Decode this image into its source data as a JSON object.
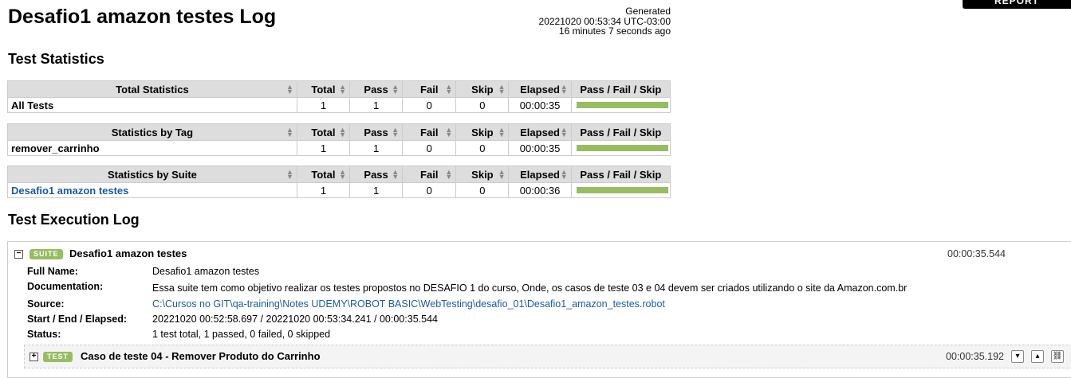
{
  "header": {
    "title": "Desafio1 amazon testes Log",
    "generated_label": "Generated",
    "generated_time": "20221020 00:53:34 UTC-03:00",
    "generated_ago": "16 minutes 7 seconds ago",
    "report_button": "REPORT"
  },
  "sections": {
    "stats_title": "Test Statistics",
    "exec_title": "Test Execution Log"
  },
  "columns": [
    "Total",
    "Pass",
    "Fail",
    "Skip",
    "Elapsed",
    "Pass / Fail / Skip"
  ],
  "stats_tables": [
    {
      "header": "Total Statistics",
      "row": {
        "name": "All Tests",
        "total": "1",
        "pass": "1",
        "fail": "0",
        "skip": "0",
        "elapsed": "00:00:35",
        "pass_ratio": 1.0
      }
    },
    {
      "header": "Statistics by Tag",
      "row": {
        "name": "remover_carrinho",
        "total": "1",
        "pass": "1",
        "fail": "0",
        "skip": "0",
        "elapsed": "00:00:35",
        "pass_ratio": 1.0
      }
    },
    {
      "header": "Statistics by Suite",
      "row": {
        "name": "Desafio1 amazon testes",
        "total": "1",
        "pass": "1",
        "fail": "0",
        "skip": "0",
        "elapsed": "00:00:36",
        "pass_ratio": 1.0
      }
    }
  ],
  "suite": {
    "label": "SUITE",
    "name": "Desafio1 amazon testes",
    "elapsed": "00:00:35.544",
    "meta": [
      {
        "key": "Full Name:",
        "value": "Desafio1 amazon testes"
      },
      {
        "key": "Documentation:",
        "value": "Essa suite tem como objetivo realizar os testes propostos no DESAFIO 1 do curso, Onde, os casos de teste 03 e 04 devem ser criados utilizando o site da Amazon.com.br"
      },
      {
        "key": "Source:",
        "value": "C:\\Cursos no GIT\\qa-training\\Notes UDEMY\\ROBOT BASIC\\WebTesting\\desafio_01\\Desafio1_amazon_testes.robot"
      },
      {
        "key": "Start / End / Elapsed:",
        "value": "20221020 00:52:58.697 / 20221020 00:53:34.241 / 00:00:35.544"
      },
      {
        "key": "Status:",
        "value": "1 test total, 1 passed, 0 failed, 0 skipped"
      }
    ],
    "test": {
      "label": "TEST",
      "name": "Caso de teste 04 - Remover Produto do Carrinho",
      "elapsed": "00:00:35.192"
    }
  },
  "colors": {
    "pass": "#97bd61",
    "link": "#1b5ba5",
    "header_bg": "#dddddd"
  },
  "icons": {
    "expand": "plus-icon",
    "collapse": "minus-icon",
    "sort": "sort-icon",
    "link": "link-icon"
  }
}
